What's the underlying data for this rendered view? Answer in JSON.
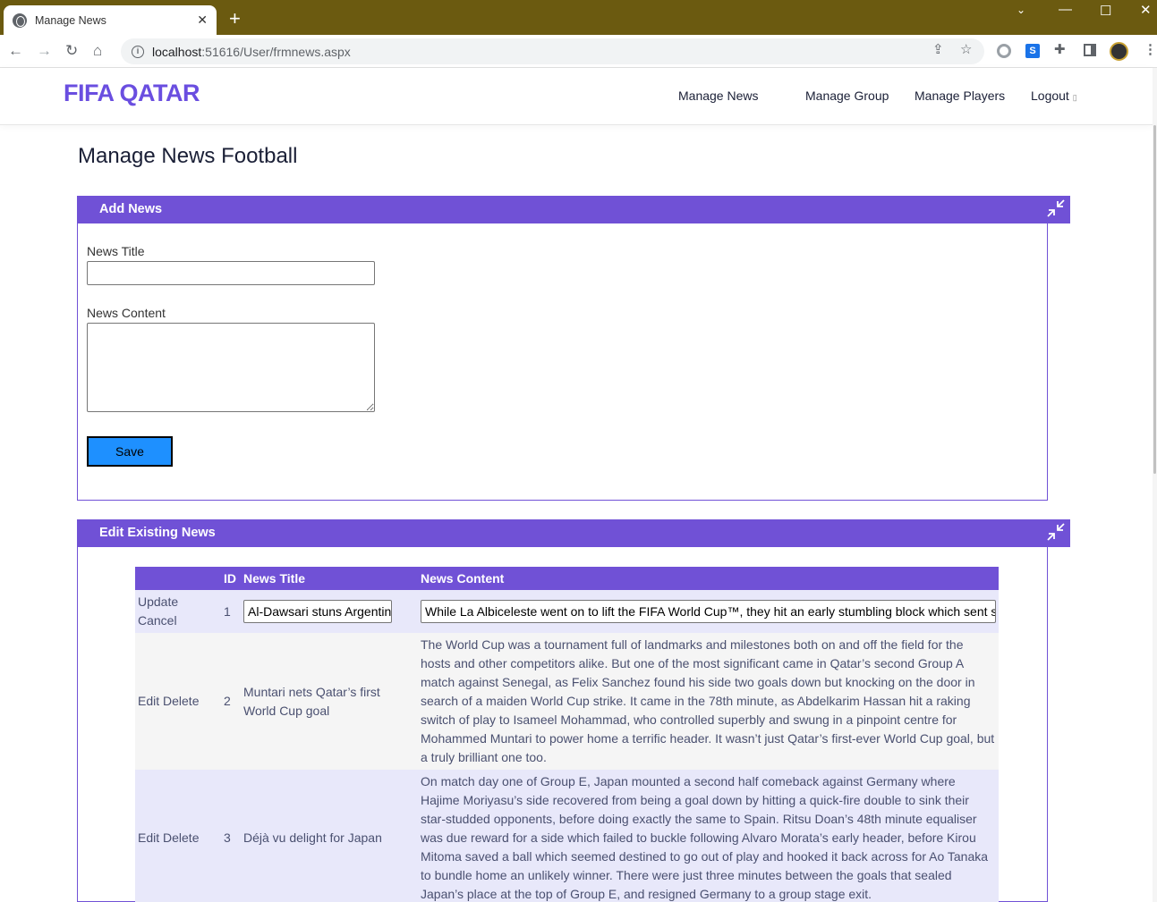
{
  "browser": {
    "tab_title": "Manage News",
    "url_host": "localhost",
    "url_rest": ":51616/User/frmnews.aspx"
  },
  "site": {
    "brand": "FIFA QATAR",
    "nav": [
      "Manage News",
      "Manage Group",
      "Manage Players",
      "Logout"
    ]
  },
  "page": {
    "title": "Manage News Football"
  },
  "add_panel": {
    "heading": "Add News",
    "title_label": "News Title",
    "title_value": "",
    "content_label": "News Content",
    "content_value": "",
    "save_label": "Save"
  },
  "edit_panel": {
    "heading": "Edit Existing News",
    "columns": [
      "ID",
      "News Title",
      "News Content"
    ],
    "rows": [
      {
        "actions": [
          "Update",
          "Cancel"
        ],
        "id": "1",
        "title": "Al-Dawsari stuns Argentina",
        "content": "While La Albiceleste went on to lift the FIFA World Cup™, they hit an early stumbling block which sent shockwaves"
      },
      {
        "actions": [
          "Edit",
          "Delete"
        ],
        "id": "2",
        "title": "Muntari nets Qatar’s first World Cup goal",
        "content": "The World Cup was a tournament full of landmarks and milestones both on and off the field for the hosts and other competitors alike. But one of the most significant came in Qatar’s second Group A match against Senegal, as Felix Sanchez found his side two goals down but knocking on the door in search of a maiden World Cup strike. It came in the 78th minute, as Abdelkarim Hassan hit a raking switch of play to Isameel Mohammad, who controlled superbly and swung in a pinpoint centre for Mohammed Muntari to power home a terrific header. It wasn’t just Qatar’s first-ever World Cup goal, but a truly brilliant one too."
      },
      {
        "actions": [
          "Edit",
          "Delete"
        ],
        "id": "3",
        "title": "Déjà vu delight for Japan",
        "content": "On match day one of Group E, Japan mounted a second half comeback against Germany where Hajime Moriyasu’s side recovered from being a goal down by hitting a quick-fire double to sink their star-studded opponents, before doing exactly the same to Spain. Ritsu Doan’s 48th minute equaliser was due reward for a side which failed to buckle following Alvaro Morata’s early header, before Kirou Mitoma saved a ball which seemed destined to go out of play and hooked it back across for Ao Tanaka to bundle home an unlikely winner. There were just three minutes between the goals that sealed Japan’s place at the top of Group E, and resigned Germany to a group stage exit."
      }
    ]
  },
  "colors": {
    "brand": "#6a4ee0",
    "panel_header": "#7051d6",
    "save_button": "#1e90ff",
    "chrome_titlebar": "#6b5a10"
  }
}
